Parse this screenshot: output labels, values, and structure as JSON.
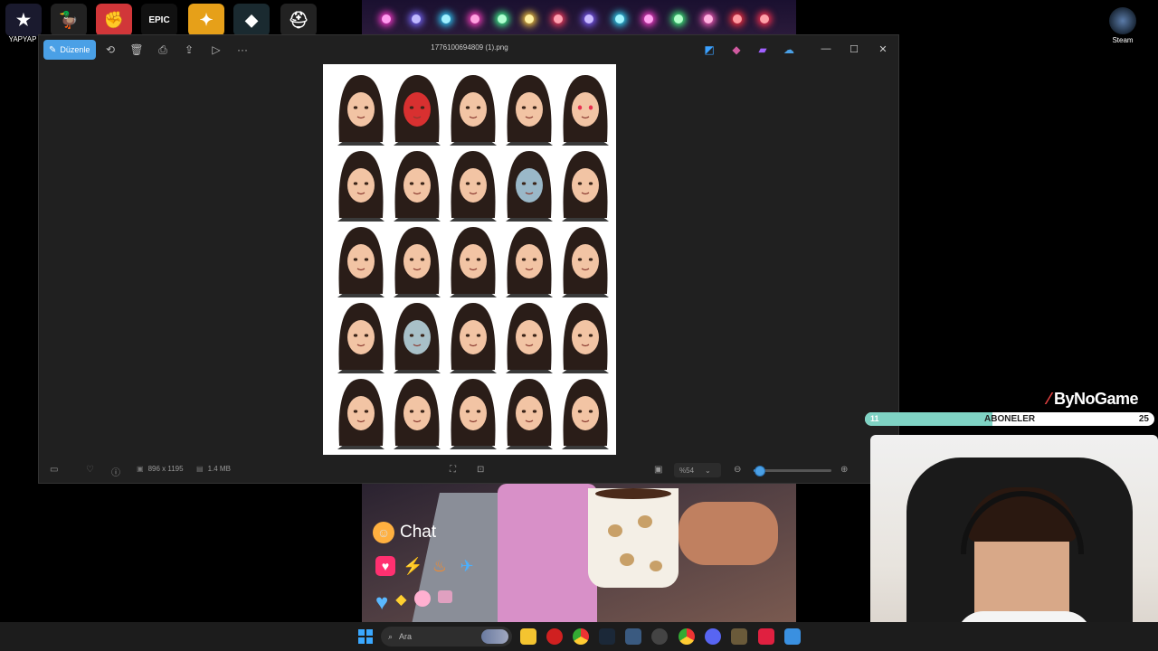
{
  "desktop": {
    "icons": [
      {
        "name": "yapyap",
        "label": "YAPYAP",
        "color": "#1a1a2e",
        "glyph": "★"
      },
      {
        "name": "goose",
        "label": "",
        "color": "#222",
        "glyph": "🦆"
      },
      {
        "name": "riot",
        "label": "",
        "color": "#d13639",
        "glyph": "✊"
      },
      {
        "name": "epic",
        "label": "",
        "color": "#111",
        "glyph": "EPIC"
      },
      {
        "name": "cs",
        "label": "",
        "color": "#e6a019",
        "glyph": "✦"
      },
      {
        "name": "valorant",
        "label": "",
        "color": "#1a2a30",
        "glyph": "◆"
      },
      {
        "name": "pubg",
        "label": "",
        "color": "#222",
        "glyph": "⛑"
      }
    ],
    "steam_label": "Steam"
  },
  "viewer": {
    "edit_label": "Düzenle",
    "file_title": "1776100694809 (1).png",
    "dimensions": "896 x 1195",
    "filesize": "1.4 MB",
    "zoom": "%54",
    "zoom_fraction": 0.07
  },
  "overlay": {
    "brand": "ByNoGame",
    "sub_left": "11",
    "sub_label": "ABONELER",
    "sub_right": "25",
    "sub_progress": 0.44
  },
  "chat_overlay": {
    "label": "Chat"
  },
  "taskbar": {
    "search_placeholder": "Ara"
  },
  "colors": {
    "accent": "#4aa0e6",
    "sub_fill": "#7fd3c4"
  }
}
